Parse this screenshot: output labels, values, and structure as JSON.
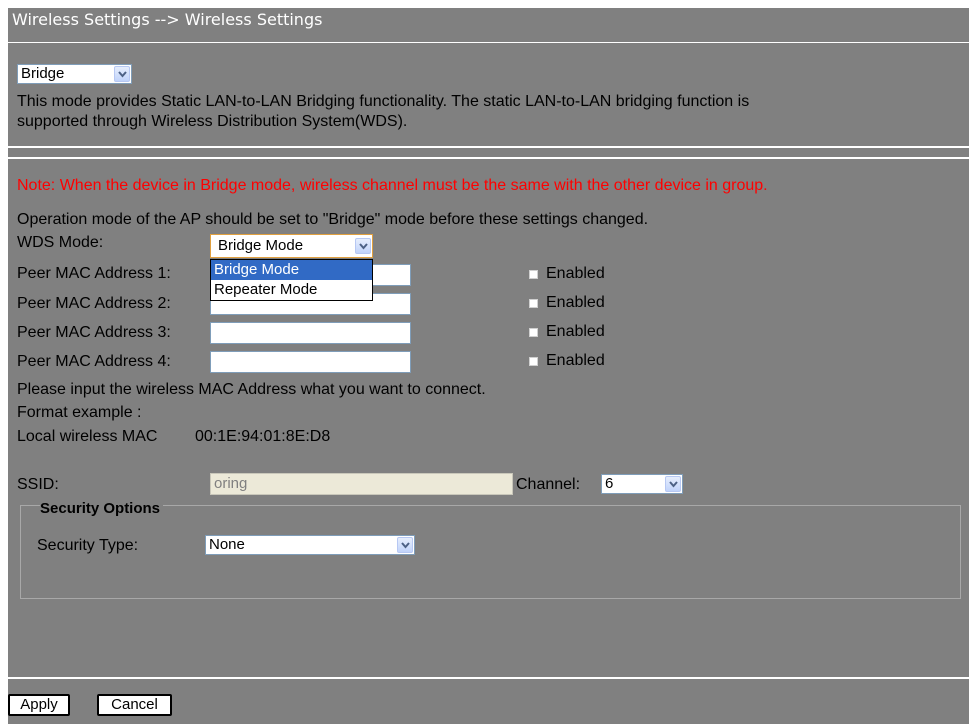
{
  "header": {
    "title": "Wireless Settings --> Wireless Settings"
  },
  "mode_select": {
    "value": "Bridge"
  },
  "mode_description": {
    "line1": "This mode provides Static LAN-to-LAN Bridging functionality. The static LAN-to-LAN bridging function is",
    "line2": "supported through Wireless Distribution System(WDS)."
  },
  "note": "Note: When the device in Bridge mode, wireless channel must be the same with the other device in group.",
  "operation_text": "Operation mode of the AP should be set to \"Bridge\" mode before these settings changed.",
  "wds": {
    "label": "WDS Mode:",
    "value": "Bridge Mode",
    "options": [
      "Bridge Mode",
      "Repeater Mode"
    ],
    "highlighted_option": "Bridge Mode"
  },
  "peers": [
    {
      "label": "Peer MAC Address 1:",
      "value": "",
      "enabled_label": "Enabled",
      "enabled": false
    },
    {
      "label": "Peer MAC Address 2:",
      "value": "",
      "enabled_label": "Enabled",
      "enabled": false
    },
    {
      "label": "Peer MAC Address 3:",
      "value": "",
      "enabled_label": "Enabled",
      "enabled": false
    },
    {
      "label": "Peer MAC Address 4:",
      "value": "",
      "enabled_label": "Enabled",
      "enabled": false
    }
  ],
  "mac_help": "Please input the wireless MAC Address what you want to connect.",
  "format_example": "Format example :",
  "local_mac": {
    "label": "Local wireless MAC",
    "value": "00:1E:94:01:8E:D8"
  },
  "ssid": {
    "label": "SSID:",
    "value": "oring"
  },
  "channel": {
    "label": "Channel:",
    "value": "6"
  },
  "security": {
    "legend": "Security Options",
    "type_label": "Security Type:",
    "type_value": "None"
  },
  "buttons": {
    "apply": "Apply",
    "cancel": "Cancel"
  },
  "colors": {
    "panel_bg": "#808080",
    "note_text": "#ff0000",
    "title_text": "#ffffff",
    "highlight": "#316ac5"
  },
  "icons": {
    "select_arrow": "chevron-down-icon"
  }
}
